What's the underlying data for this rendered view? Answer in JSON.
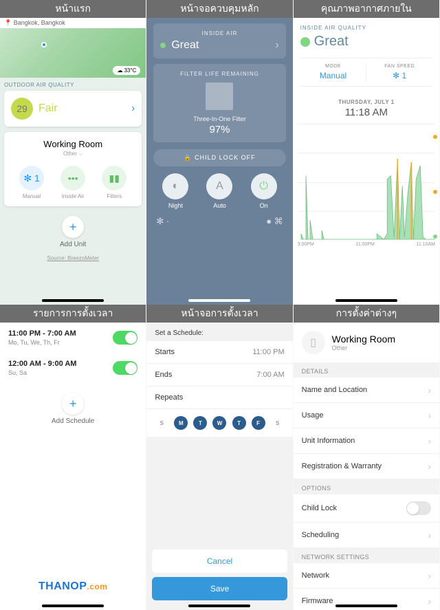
{
  "headers": [
    "หน้าแรก",
    "หน้าจอควบคุมหลัก",
    "คุณภาพอากาศภายใน",
    "รายการการตั้งเวลา",
    "หน้าจอการตั้งเวลา",
    "การตั้งค่าต่างๆ"
  ],
  "p1": {
    "location": "Bangkok, Bangkok",
    "temp": "33°C",
    "aq_section": "OUTDOOR AIR QUALITY",
    "aq_value": "29",
    "aq_text": "Fair",
    "room": {
      "title": "Working Room",
      "sub": "Other ⌵",
      "items": [
        {
          "icon": "✻ 1",
          "label": "Manual"
        },
        {
          "icon": "•••",
          "label": "Inside Air"
        },
        {
          "icon": "▮▮",
          "label": "Filters"
        }
      ]
    },
    "add": "Add Unit",
    "source": "Source: BreezoMeter"
  },
  "p2": {
    "inside": {
      "label": "INSIDE AIR",
      "value": "Great"
    },
    "filter": {
      "label": "FILTER LIFE REMAINING",
      "name": "Three-In-One Filter",
      "pct": "97%"
    },
    "lock": "🔒 CHILD LOCK OFF",
    "modes": [
      {
        "icon": "◐",
        "label": "Night"
      },
      {
        "icon": "A",
        "label": "Auto"
      },
      {
        "icon": "⏻",
        "label": "On"
      }
    ]
  },
  "p3": {
    "label": "INSIDE AIR QUALITY",
    "value": "Great",
    "cols": [
      {
        "l": "MODE",
        "v": "Manual"
      },
      {
        "l": "FAN SPEED",
        "v": "✻ 1"
      }
    ],
    "date": "THURSDAY, JULY 1",
    "time": "11:18 AM",
    "axis": [
      "3:00PM",
      "11:00PM",
      "11:10AM"
    ]
  },
  "p4": {
    "schedules": [
      {
        "time": "11:00 PM  -  7:00 AM",
        "days": "Mo, Tu, We, Th, Fr"
      },
      {
        "time": "12:00 AM  -  9:00 AM",
        "days": "Su, Sa"
      }
    ],
    "add": "Add Schedule",
    "logo": {
      "a": "THANOP",
      "b": ".com"
    }
  },
  "p5": {
    "head": "Set a Schedule:",
    "rows": [
      [
        "Starts",
        "11:00 PM"
      ],
      [
        "Ends",
        "7:00 AM"
      ],
      [
        "Repeats",
        ""
      ]
    ],
    "days": [
      [
        "S",
        false
      ],
      [
        "M",
        true
      ],
      [
        "T",
        true
      ],
      [
        "W",
        true
      ],
      [
        "T",
        true
      ],
      [
        "F",
        true
      ],
      [
        "S",
        false
      ]
    ],
    "cancel": "Cancel",
    "save": "Save"
  },
  "p6": {
    "title": "Working Room",
    "sub": "Other",
    "sections": [
      {
        "head": "DETAILS",
        "rows": [
          "Name and Location",
          "Usage",
          "Unit Information",
          "Registration & Warranty"
        ]
      },
      {
        "head": "OPTIONS",
        "rows": [
          "Child Lock",
          "Scheduling"
        ]
      },
      {
        "head": "NETWORK SETTINGS",
        "rows": [
          "Network",
          "Firmware"
        ]
      }
    ]
  }
}
